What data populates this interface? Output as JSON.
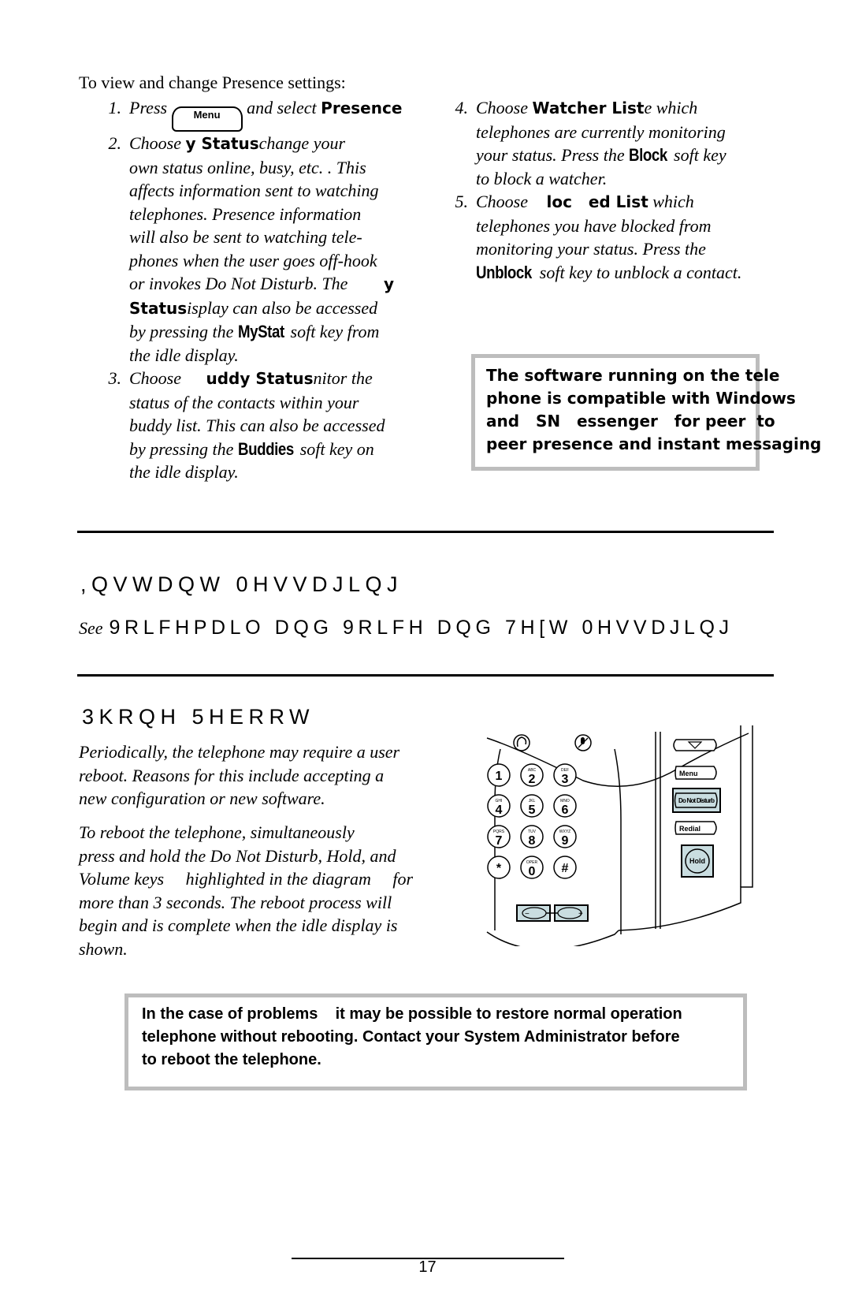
{
  "intro": "To view and change Presence settings:",
  "steps_left": [
    {
      "num": "1.",
      "lines": [
        {
          "pre": "Press ",
          "key": "Menu",
          "post": " and select ",
          "bold": "Presence"
        }
      ]
    },
    {
      "num": "2.",
      "lines": [
        {
          "pre": "Choose ",
          "bold": "y Status",
          "post": "change your"
        },
        {
          "text": "own status    online, busy, etc.    .  This"
        },
        {
          "text": "affects information sent to watching"
        },
        {
          "text": "telephones.  Presence information"
        },
        {
          "text": "will also be sent to watching tele-"
        },
        {
          "text": "phones when the user goes off-hook"
        },
        {
          "pre": "or invokes Do Not Disturb.  The ",
          "bold": "y"
        },
        {
          "bold": "Status",
          "post": "isplay can also be accessed"
        },
        {
          "pre": "by pressing the ",
          "softkey": "MyStat",
          "post": " soft key from"
        },
        {
          "text": "the idle display."
        }
      ]
    },
    {
      "num": "3.",
      "lines": [
        {
          "pre": "Choose ",
          "bold": "uddy Status",
          "post": "nitor the"
        },
        {
          "text": "status of the contacts within your"
        },
        {
          "text": "buddy list.  This can also be accessed"
        },
        {
          "pre": "by pressing the ",
          "softkey": "Buddies",
          "post": " soft key on"
        },
        {
          "text": "the idle display."
        }
      ]
    }
  ],
  "steps_right": [
    {
      "num": "4.",
      "lines": [
        {
          "pre": "Choose ",
          "bold": "Watcher List",
          "post": "e which"
        },
        {
          "text": "telephones are currently monitoring"
        },
        {
          "pre": "your status.  Press the ",
          "softkey": "Block",
          "post": " soft key"
        },
        {
          "text": "to block a watcher."
        }
      ]
    },
    {
      "num": "5.",
      "lines": [
        {
          "pre": "Choose ",
          "bold": "loc   ed List",
          "post": " which"
        },
        {
          "text": "telephones you have blocked from"
        },
        {
          "text": "monitoring your status.  Press the"
        },
        {
          "softkey": "Unblock",
          "post": " soft key to unblock a contact."
        }
      ]
    }
  ],
  "note1": [
    "The software running on the tele",
    "phone is compatible with Windows",
    "and   SN   essenger   for peer  to",
    "peer presence and instant messaging"
  ],
  "section_im": {
    "heading": ",QVWDQW 0HVVDJLQJ",
    "see_prefix": "See",
    "see_text": "9RLFHPDLO DQG 9RLFH DQG 7H[W 0HVVDJLQJ"
  },
  "section_reboot": {
    "heading": "3KRQH 5HERRW",
    "para1": [
      "Periodically, the telephone may require a user",
      "reboot.  Reasons for this include accepting a",
      "new configuration or new software."
    ],
    "para2": [
      "To reboot the telephone, simultaneously",
      "press and hold the Do Not Disturb, Hold, and",
      "Volume keys     highlighted in the diagram     for",
      "more than 3 seconds.  The reboot process will",
      "begin and is complete when the idle display is",
      "shown."
    ]
  },
  "phone_diagram": {
    "keys": [
      {
        "digit": "1",
        "letters": ""
      },
      {
        "digit": "2",
        "letters": "ABC"
      },
      {
        "digit": "3",
        "letters": "DEF"
      },
      {
        "digit": "4",
        "letters": "GHI"
      },
      {
        "digit": "5",
        "letters": "JKL"
      },
      {
        "digit": "6",
        "letters": "MNO"
      },
      {
        "digit": "7",
        "letters": "PQRS"
      },
      {
        "digit": "8",
        "letters": "TUV"
      },
      {
        "digit": "9",
        "letters": "WXYZ"
      },
      {
        "digit": "*",
        "letters": ""
      },
      {
        "digit": "0",
        "letters": "OPER"
      },
      {
        "digit": "#",
        "letters": ""
      }
    ],
    "side_keys": {
      "menu": "Menu",
      "dnd": "Do Not Disturb",
      "redial": "Redial",
      "hold": "Hold"
    },
    "highlight_color": "#c9dde0"
  },
  "note2": [
    "In the case of problems    it may be possible to restore normal operation",
    "telephone without rebooting.  Contact your System Administrator before",
    "to reboot the telephone."
  ],
  "page_number": "17"
}
